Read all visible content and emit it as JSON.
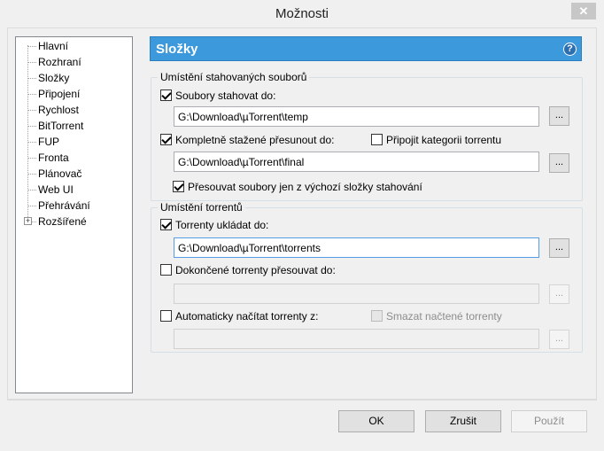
{
  "window": {
    "title": "Možnosti",
    "close_glyph": "✕"
  },
  "tree": {
    "items": [
      {
        "label": "Hlavní"
      },
      {
        "label": "Rozhraní"
      },
      {
        "label": "Složky"
      },
      {
        "label": "Připojení"
      },
      {
        "label": "Rychlost"
      },
      {
        "label": "BitTorrent"
      },
      {
        "label": "FUP"
      },
      {
        "label": "Fronta"
      },
      {
        "label": "Plánovač"
      },
      {
        "label": "Web UI"
      },
      {
        "label": "Přehrávání"
      },
      {
        "label": "Rozšířené",
        "expandable": true,
        "expander_glyph": "+"
      }
    ],
    "selected": "Složky"
  },
  "page": {
    "title": "Složky",
    "help_glyph": "?"
  },
  "downloads_group": {
    "legend": "Umístění stahovaných souborů",
    "download_to": {
      "label": "Soubory stahovat do:",
      "checked": true,
      "path": "G:\\Download\\µTorrent\\temp"
    },
    "move_completed": {
      "label": "Kompletně stažené přesunout do:",
      "checked": true,
      "path": "G:\\Download\\µTorrent\\final"
    },
    "append_label": {
      "label": "Připojit kategorii torrentu",
      "checked": false
    },
    "only_from_default": {
      "label": "Přesouvat soubory jen z výchozí složky stahování",
      "checked": true
    },
    "browse_label": "..."
  },
  "torrents_group": {
    "legend": "Umístění torrentů",
    "store_torrents": {
      "label": "Torrenty ukládat do:",
      "checked": true,
      "path": "G:\\Download\\µTorrent\\torrents"
    },
    "move_finished": {
      "label": "Dokončené torrenty přesouvat do:",
      "checked": false,
      "path": ""
    },
    "auto_load": {
      "label": "Automaticky načítat torrenty z:",
      "checked": false,
      "path": ""
    },
    "delete_loaded": {
      "label": "Smazat načtené torrenty",
      "checked": false,
      "enabled": false
    },
    "browse_label": "..."
  },
  "footer": {
    "ok": "OK",
    "cancel": "Zrušit",
    "apply": "Použít"
  }
}
